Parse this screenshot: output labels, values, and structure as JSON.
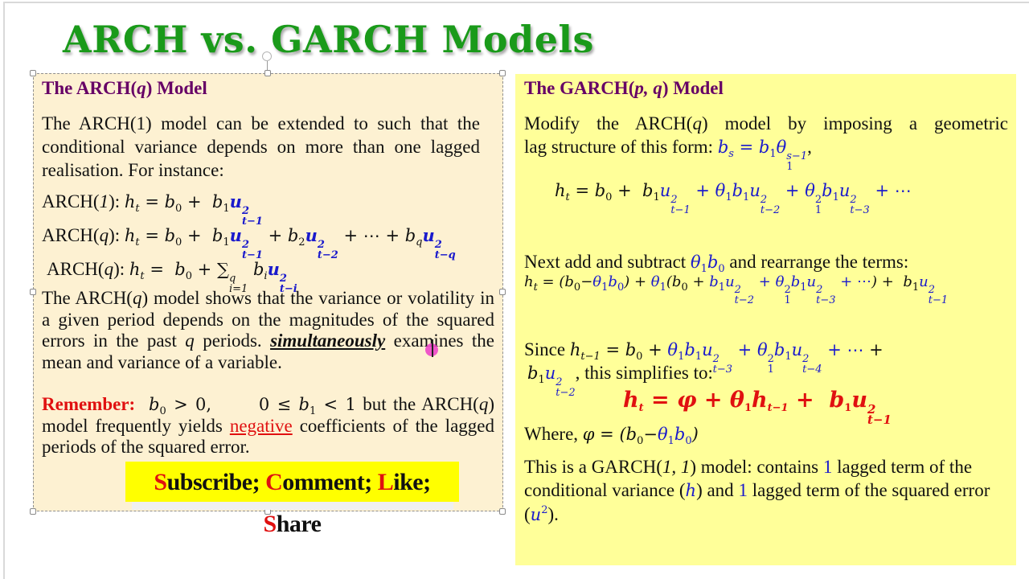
{
  "slide": {
    "title": "ARCH vs. GARCH Models"
  },
  "left": {
    "heading_prefix": "The ARCH(",
    "heading_var": "q",
    "heading_suffix": ") Model",
    "intro": "The ARCH(1) model can be extended to such that the conditional variance depends on more than one lagged realisation. For instance:",
    "eq1": {
      "label_prefix": "ARCH(",
      "label_var": "1",
      "label_suffix": "): ",
      "lhs": "h",
      "lhs_sub": "t",
      "rhs": "= b",
      "b0_sub": "0",
      "plus": " +  b",
      "b1_sub": "1",
      "u": "u",
      "u_sup": "2",
      "u_sub": "t−1"
    },
    "eq2": {
      "label_prefix": "ARCH(",
      "label_var": "q",
      "label_suffix": "): ",
      "text": "h_t = b_0 + b_1 u²_{t−1} + b_2 u²_{t−2} + ⋯ + b_q u²_{t−q}"
    },
    "eq3": {
      "label_prefix": "ARCH(",
      "label_var": "q",
      "label_suffix": "): ",
      "text": "h_t = b_0 + Σ_{i=1}^{q} b_i u²_{t−i}"
    },
    "para2_a": "The ARCH(",
    "para2_q": "q",
    "para2_b": ") model shows that the variance or volatility in a given period depends on the magnitudes of the squared errors in the past ",
    "para2_q2": "q",
    "para2_c": " periods. ",
    "para2_emph": "simultaneously",
    "para2_d": " examines the mean and variance of a variable.",
    "remember_label": "Remember:",
    "remember_cond1": "b_0 > 0,",
    "remember_cond2": "0 ≤ b_1 < 1",
    "remember_a": " but the ARCH(",
    "remember_q": "q",
    "remember_b": ") model frequently yields ",
    "remember_neg": "negative",
    "remember_c": " coefficients of the lagged periods of the squared error.",
    "banner": [
      {
        "cap": "S",
        "rest": "ubscribe; "
      },
      {
        "cap": "C",
        "rest": "omment; "
      },
      {
        "cap": "L",
        "rest": "ike; "
      },
      {
        "cap": "S",
        "rest": "hare"
      }
    ]
  },
  "right": {
    "heading_prefix": "The GARCH(",
    "heading_var": "p, q",
    "heading_suffix": ") Model",
    "intro_a": "Modify the ARCH(",
    "intro_q": "q",
    "intro_b": ") model by imposing a geometric lag structure of this form: ",
    "intro_eq": "b_s = b_1 θ_1^{s−1}",
    "intro_end": ",",
    "eq_expand": "h_t = b_0 + b_1 u²_{t−1} + θ_1 b_1 u²_{t−2} + θ_1² b_1 u²_{t−3} + ⋯",
    "next_a": "Next add and subtract ",
    "next_term": "θ_1 b_0",
    "next_b": " and rearrange the terms:",
    "eq_rearranged": "h_t = (b_0 − θ_1 b_0) + θ_1(b_0 + b_1 u²_{t−2} + θ_1² b_1 u²_{t−3} + ⋯) + b_1 u²_{t−1}",
    "since_a": "Since ",
    "since_eq": "h_{t−1} = b_0 + θ_1 b_1 u²_{t−3} + θ_1² b_1 u²_{t−4} + ⋯ + b_1 u²_{t−2}",
    "since_b": ", this simplifies to:",
    "final_eq": "h_t = φ + θ_1 h_{t−1} + b_1 u²_{t−1}",
    "where_a": "Where, ",
    "where_eq": "φ = (b_0 − θ_1 b_0)",
    "summary_a": "This is a GARCH(",
    "summary_var": "1, 1",
    "summary_b": ") model: contains ",
    "summary_n1": "1",
    "summary_c": " lagged term of the conditional variance (",
    "summary_h": "h",
    "summary_d": ") and ",
    "summary_n2": "1",
    "summary_e": " lagged term of the squared error (",
    "summary_u": "u²",
    "summary_f": ")."
  }
}
